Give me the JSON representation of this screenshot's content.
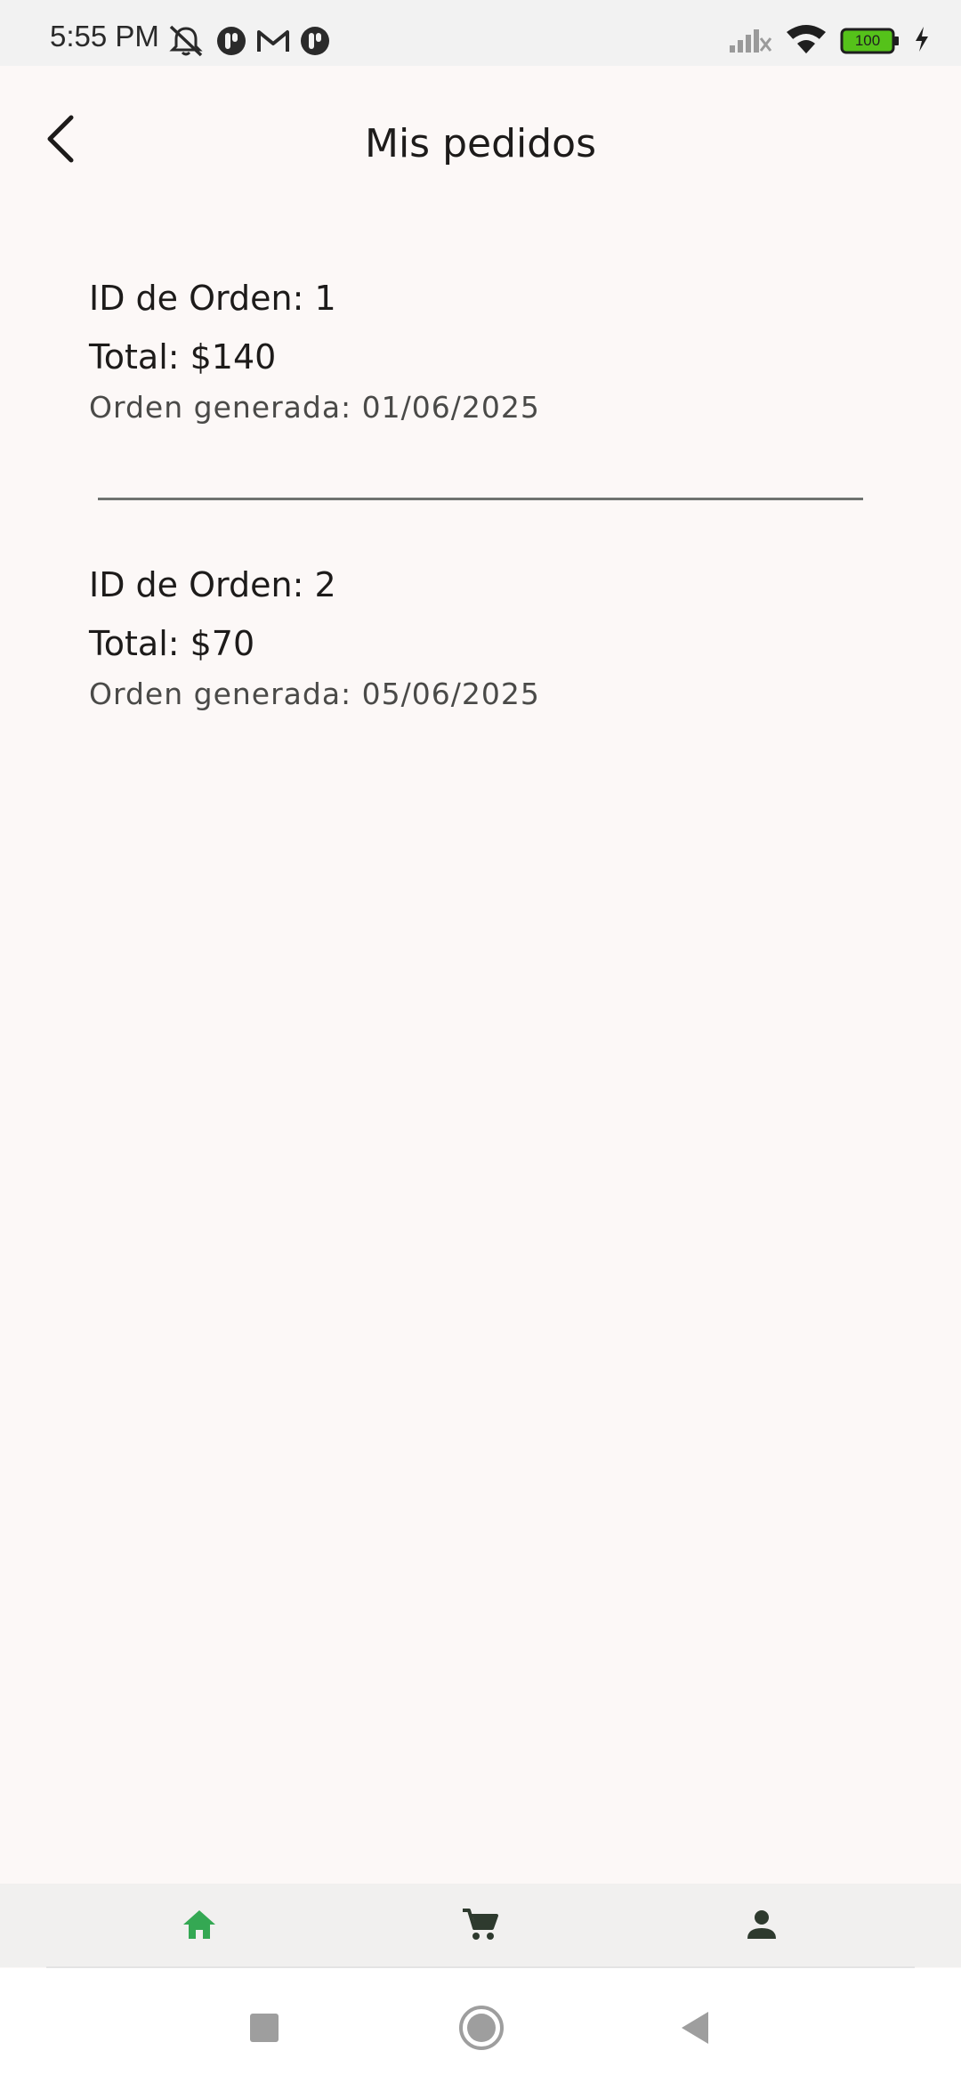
{
  "status_bar": {
    "time": "5:55 PM",
    "battery": "100",
    "left_icons": [
      "mute-icon",
      "notification-app-icon",
      "gmail-icon",
      "notification-app-icon"
    ],
    "right_icons": [
      "signal-icon",
      "wifi-icon",
      "battery-icon",
      "charging-icon"
    ]
  },
  "header": {
    "title": "Mis pedidos",
    "back_icon": "back-arrow-icon"
  },
  "orders": [
    {
      "id_label": "ID de Orden: 1",
      "total_label": "Total: $140",
      "date_label": "Orden generada: 01/06/2025"
    },
    {
      "id_label": "ID de Orden: 2",
      "total_label": "Total: $70",
      "date_label": "Orden generada: 05/06/2025"
    }
  ],
  "bottom_nav": {
    "items": [
      {
        "icon": "home-icon",
        "active": true
      },
      {
        "icon": "cart-icon",
        "active": false
      },
      {
        "icon": "profile-icon",
        "active": false
      }
    ],
    "active_color": "#34a853",
    "inactive_color": "#2e3a2e"
  },
  "system_nav": {
    "buttons": [
      "recents-icon",
      "home-circle-icon",
      "back-triangle-icon"
    ]
  },
  "colors": {
    "background": "#fcf8f7",
    "text_primary": "#1d1b1a",
    "text_secondary": "#4a4a48",
    "divider": "#6f7370",
    "battery_green": "#55c21a"
  }
}
